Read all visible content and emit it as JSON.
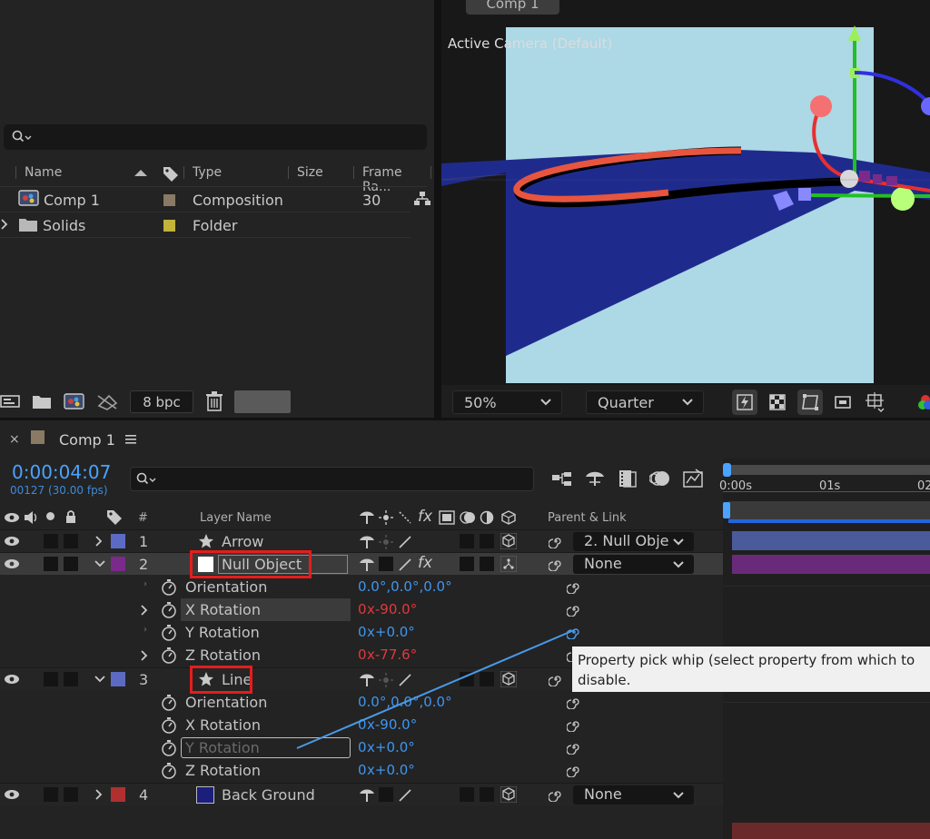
{
  "project": {
    "search_placeholder": "",
    "columns": {
      "name": "Name",
      "type": "Type",
      "size": "Size",
      "frame_rate": "Frame Ra..."
    },
    "items": [
      {
        "name": "Comp 1",
        "type": "Composition",
        "frame_rate": "30",
        "label_color": "#8a7a64",
        "icon": "composition-icon"
      },
      {
        "name": "Solids",
        "type": "Folder",
        "frame_rate": "",
        "label_color": "#c2b33a",
        "icon": "folder-icon"
      }
    ],
    "bit_depth": "8 bpc"
  },
  "viewer": {
    "tab_label": "Comp 1",
    "camera_label": "Active Camera (Default)",
    "magnification": "50%",
    "resolution": "Quarter"
  },
  "timeline": {
    "tab_label": "Comp 1",
    "timecode": "0:00:04:07",
    "frames": "00127 (30.00 fps)",
    "headers": {
      "number": "#",
      "layer_name": "Layer Name",
      "parent": "Parent & Link"
    },
    "ruler": {
      "t0": "0:00s",
      "t1": "01s",
      "t2": "02"
    },
    "layers": [
      {
        "num": "1",
        "name": "Arrow",
        "label_color": "#5b6bc4",
        "parent": "2. Null Obje",
        "type": "shape"
      },
      {
        "num": "2",
        "name": "Null Object",
        "label_color": "#7a2a8a",
        "parent": "None",
        "type": "null",
        "properties": [
          {
            "name": "Orientation",
            "value_parts": [
              "0.0°,0.0°,0.0°"
            ]
          },
          {
            "name": "X Rotation",
            "revs": "0",
            "deg": "x-90.0°",
            "color": "red"
          },
          {
            "name": "Y Rotation",
            "revs": "0",
            "deg": "x+0.0°",
            "color": "blue"
          },
          {
            "name": "Z Rotation",
            "revs": "0",
            "deg": "x-77.6°",
            "color": "red"
          }
        ]
      },
      {
        "num": "3",
        "name": "Line",
        "label_color": "#5b6bc4",
        "type": "shape",
        "properties": [
          {
            "name": "Orientation",
            "value_parts": [
              "0.0°,0.0°,0.0°"
            ]
          },
          {
            "name": "X Rotation",
            "revs": "0",
            "deg": "x-90.0°",
            "color": "blue"
          },
          {
            "name": "Y Rotation",
            "revs": "0",
            "deg": "x+0.0°",
            "color": "blue"
          },
          {
            "name": "Z Rotation",
            "revs": "0",
            "deg": "x+0.0°",
            "color": "blue"
          }
        ]
      },
      {
        "num": "4",
        "name": "Back Ground",
        "label_color": "#b03030",
        "parent": "None",
        "type": "solid",
        "solid_color": "#1b1e7a"
      }
    ],
    "tooltip": "Property pick whip (select property from which to\ndisable."
  }
}
